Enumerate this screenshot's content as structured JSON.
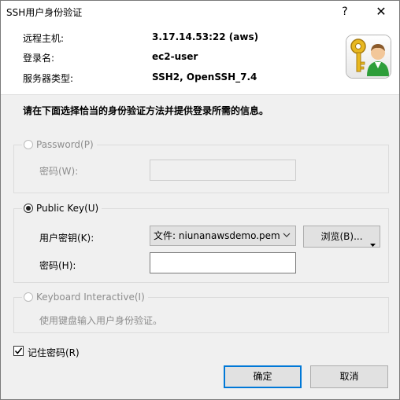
{
  "window": {
    "title": "SSH用户身份验证",
    "help_glyph": "?",
    "close_glyph": "✕"
  },
  "info": {
    "host_label": "远程主机:",
    "host_value": "3.17.14.53:22 (aws)",
    "login_label": "登录名:",
    "login_value": "ec2-user",
    "server_label": "服务器类型:",
    "server_value": "SSH2, OpenSSH_7.4"
  },
  "instruction": "请在下面选择恰当的身份验证方法并提供登录所需的信息。",
  "password_group": {
    "label": "Password(P)",
    "selected": false,
    "enabled": false,
    "field_label": "密码(W):",
    "field_value": ""
  },
  "publickey_group": {
    "label": "Public Key(U)",
    "selected": true,
    "enabled": true,
    "key_label": "用户密钥(K):",
    "key_value": "文件: niunanawsdemo.pem",
    "browse_label": "浏览(B)...",
    "passphrase_label": "密码(H):",
    "passphrase_value": ""
  },
  "keyboard_group": {
    "label": "Keyboard Interactive(I)",
    "selected": false,
    "enabled": false,
    "description": "使用键盘输入用户身份验证。"
  },
  "remember": {
    "label": "记住密码(R)",
    "checked": true
  },
  "buttons": {
    "ok": "确定",
    "cancel": "取消"
  },
  "icons": {
    "dialog_icon": "user-key-icon",
    "chevron": "chevron-down-icon",
    "browse_arrow": "dropdown-arrow-icon",
    "check": "checkmark-icon"
  },
  "colors": {
    "dialog_bg": "#f0f0f0",
    "accent": "#0078d7",
    "disabled_text": "#8d8d8d"
  }
}
